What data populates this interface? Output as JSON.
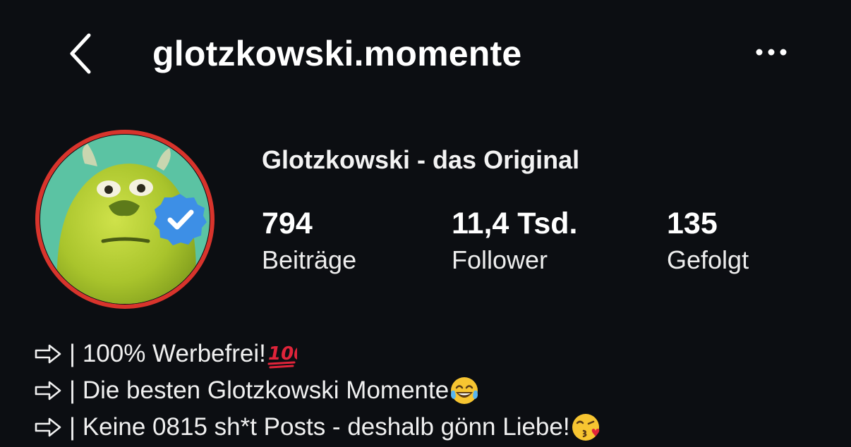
{
  "header": {
    "username": "glotzkowski.momente",
    "back_icon": "chevron-left-icon",
    "more_icon": "more-horizontal-icon"
  },
  "profile": {
    "display_name": "Glotzkowski - das Original",
    "verified": true,
    "avatar_ring_color": "#d8342c",
    "avatar_bg_color": "#5bc3a3",
    "badge_color": "#3d8fe6"
  },
  "stats": [
    {
      "count": "794",
      "label": "Beiträge"
    },
    {
      "count": "11,4 Tsd.",
      "label": "Follower"
    },
    {
      "count": "135",
      "label": "Gefolgt"
    }
  ],
  "bio": {
    "lines": [
      {
        "arrow": "⇨",
        "text": "| 100% Werbefrei! ",
        "emoji": "hundred-points-emoji"
      },
      {
        "arrow": "⇨",
        "text": "| Die besten Glotzkowski Momente",
        "emoji": "tears-of-joy-emoji"
      },
      {
        "arrow": "⇨",
        "text": "| Keine 0815 sh*t Posts - deshalb gönn Liebe!",
        "emoji": "kissing-heart-emoji"
      }
    ]
  }
}
